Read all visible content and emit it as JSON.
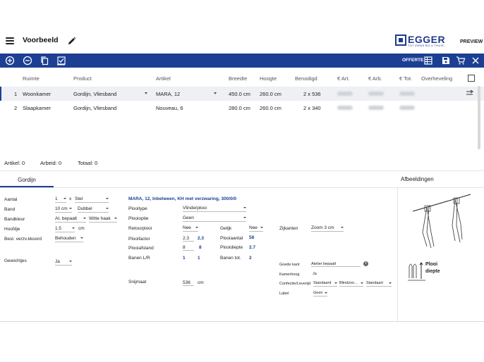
{
  "header": {
    "title": "Voorbeeld",
    "brand": "EGGER",
    "brand_tagline": "TOT ZIENS BIJ U THUIS",
    "preview_label": "PREVIEW"
  },
  "toolbar": {
    "offerte_label": "OFFERTE",
    "colors": {
      "bar": "#1c3f94"
    }
  },
  "grid": {
    "columns": {
      "ruimte": "Ruimte",
      "product": "Product",
      "artikel": "Artikel",
      "breedte": "Breedte",
      "hoogte": "Hoogte",
      "benodigd": "Benodigd",
      "art": "€ Art.",
      "arb": "€ Arb.",
      "tot": "€ Tot.",
      "overheveling": "Overheveling"
    },
    "rows": [
      {
        "nr": "1",
        "ruimte": "Woonkamer",
        "product": "Gordijn, Vliesband",
        "artikel": "MARA, 12",
        "breedte": "450.0 cm",
        "hoogte": "260.0 cm",
        "benodigd": "2 x 536"
      },
      {
        "nr": "2",
        "ruimte": "Slaapkamer",
        "product": "Gordijn, Vliesband",
        "artikel": "Nouveau, 6",
        "breedte": "280.0 cm",
        "hoogte": "260.0 cm",
        "benodigd": "2 x 340"
      }
    ]
  },
  "totals": {
    "artikel": "Artikel: 0",
    "arbeid": "Arbeid: 0",
    "totaal": "Totaal: 0"
  },
  "tabs": {
    "gordijn": "Gordijn",
    "afbeeldingen": "Afbeeldingen"
  },
  "form": {
    "aantal_label": "Aantal",
    "aantal_value": "1",
    "aantal_x": "x",
    "aantal_unit": "Stel",
    "band_label": "Band",
    "band_size": "10 cm",
    "band_type": "Dubbel",
    "bandkleur_label": "Bandkleur",
    "bandkleur_mode": "At. bepaalt",
    "bandkleur_color": "Witte haak",
    "hoofdje_label": "Hoofdje",
    "hoofdje_value": "1.5",
    "hoofdje_unit": "cm",
    "koord_label": "Best. verzv.kkoord",
    "koord_value": "Behouden",
    "gewichtjes_label": "Gewichtjes",
    "gewichtjes_value": "Ja",
    "heading": "MARA, 12, Inbetween, KH met verzwaring, 300/0/0",
    "plooitype_label": "Plooitype",
    "plooitype_value": "Vlinderplooi",
    "plooioptie_label": "Plooioptie",
    "plooioptie_value": "Geen",
    "retourplooi_label": "Retourplooi",
    "retourplooi_value": "Nee",
    "gelijk_label": "Gelijk",
    "gelijk_value": "Nee",
    "zijkanten_label": "Zijkanten",
    "zijkanten_value": "Zoom 3 cm",
    "plooifactor_label": "Plooifactor",
    "plooifactor_input": "2.3",
    "plooifactor_calc": "2.3",
    "plooiaantal_label": "Plooiaantal",
    "plooiaantal_value": "58",
    "plooiafstand_label": "Plooiafstand",
    "plooiafstand_input": "8",
    "plooiafstand_calc": "8",
    "plooidiepte_label": "Plooidiepte",
    "plooidiepte_value": "2.7",
    "banen_label": "Banen L/R",
    "banen_l": "1",
    "banen_r": "1",
    "banentot_label": "Banen tot.",
    "banentot_value": "2",
    "snijmaat_label": "Snijmaat",
    "snijmaat_value": "536",
    "snijmaat_unit": "cm",
    "goedekant_label": "Goede kant",
    "goedekant_value": "Atelier bepaalt",
    "kamerhoog_label": "Kamerhoog",
    "kamerhoog_value": "Ja",
    "confectie_label": "Confectie/Leverijd",
    "confectie_1": "Standaard",
    "confectie_2": "Blindzoo...",
    "confectie_3": "Standaart",
    "label_label": "Label",
    "label_value": "Geen"
  },
  "illustration": {
    "plooi_label_1": "Plooi",
    "plooi_label_2": "diepte"
  }
}
